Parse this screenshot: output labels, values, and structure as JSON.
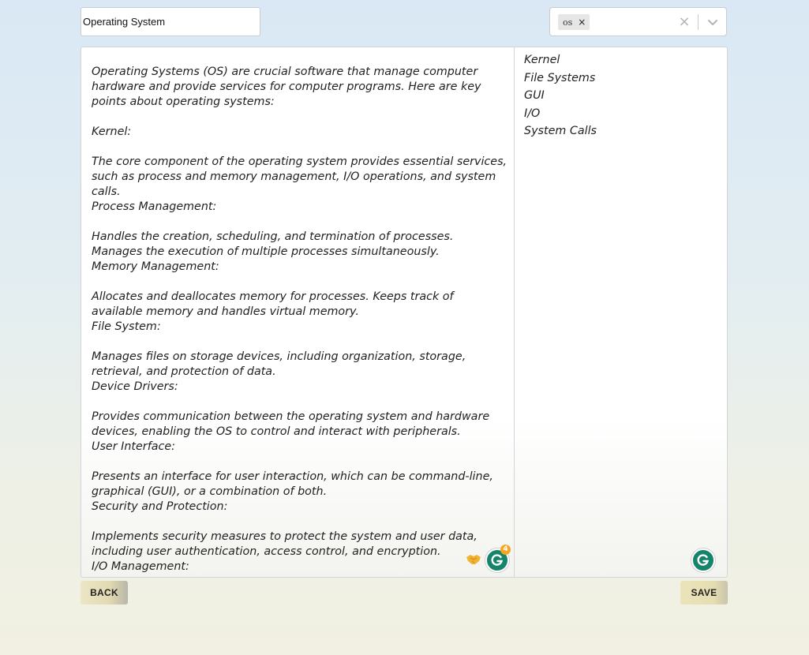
{
  "title_field": {
    "value": "Operating System"
  },
  "tags": {
    "selected": [
      "os"
    ],
    "remove_glyph": "×",
    "clear_glyph": "×"
  },
  "editor": {
    "paragraphs": [
      "Operating Systems (OS) are crucial software that manage computer hardware and provide services for computer programs. Here are key points about operating systems:",
      "",
      "Kernel:",
      "",
      "The core component of the operating system provides essential services, such as process and memory management, I/O operations, and system calls.",
      "Process Management:",
      "",
      "Handles the creation, scheduling, and termination of processes. Manages the execution of multiple processes simultaneously.",
      "Memory Management:",
      "",
      "Allocates and deallocates memory for processes. Keeps track of available memory and handles virtual memory.",
      "File System:",
      "",
      "Manages files on storage devices, including organization, storage, retrieval, and protection of data.",
      "Device Drivers:",
      "",
      "Provides communication between the operating system and hardware devices, enabling the OS to control and interact with peripherals.",
      "User Interface:",
      "",
      "Presents an interface for user interaction, which can be command-line, graphical (GUI), or a combination of both.",
      "Security and Protection:",
      "",
      "Implements security measures to protect the system and user data, including user authentication, access control, and encryption.",
      "I/O Management:"
    ]
  },
  "outline": {
    "items": [
      "Kernel",
      "File Systems",
      "GUI",
      "I/O",
      "System Calls"
    ]
  },
  "grammarly": {
    "badge_count": "4"
  },
  "icons": {
    "hand": "handshake-icon",
    "grammarly": "grammarly-icon",
    "chevron": "chevron-down-icon",
    "clear": "clear-icon",
    "accent": "#15846b",
    "badge": "#f5a623"
  },
  "buttons": {
    "back_label": "BACK",
    "save_label": "SAVE"
  }
}
